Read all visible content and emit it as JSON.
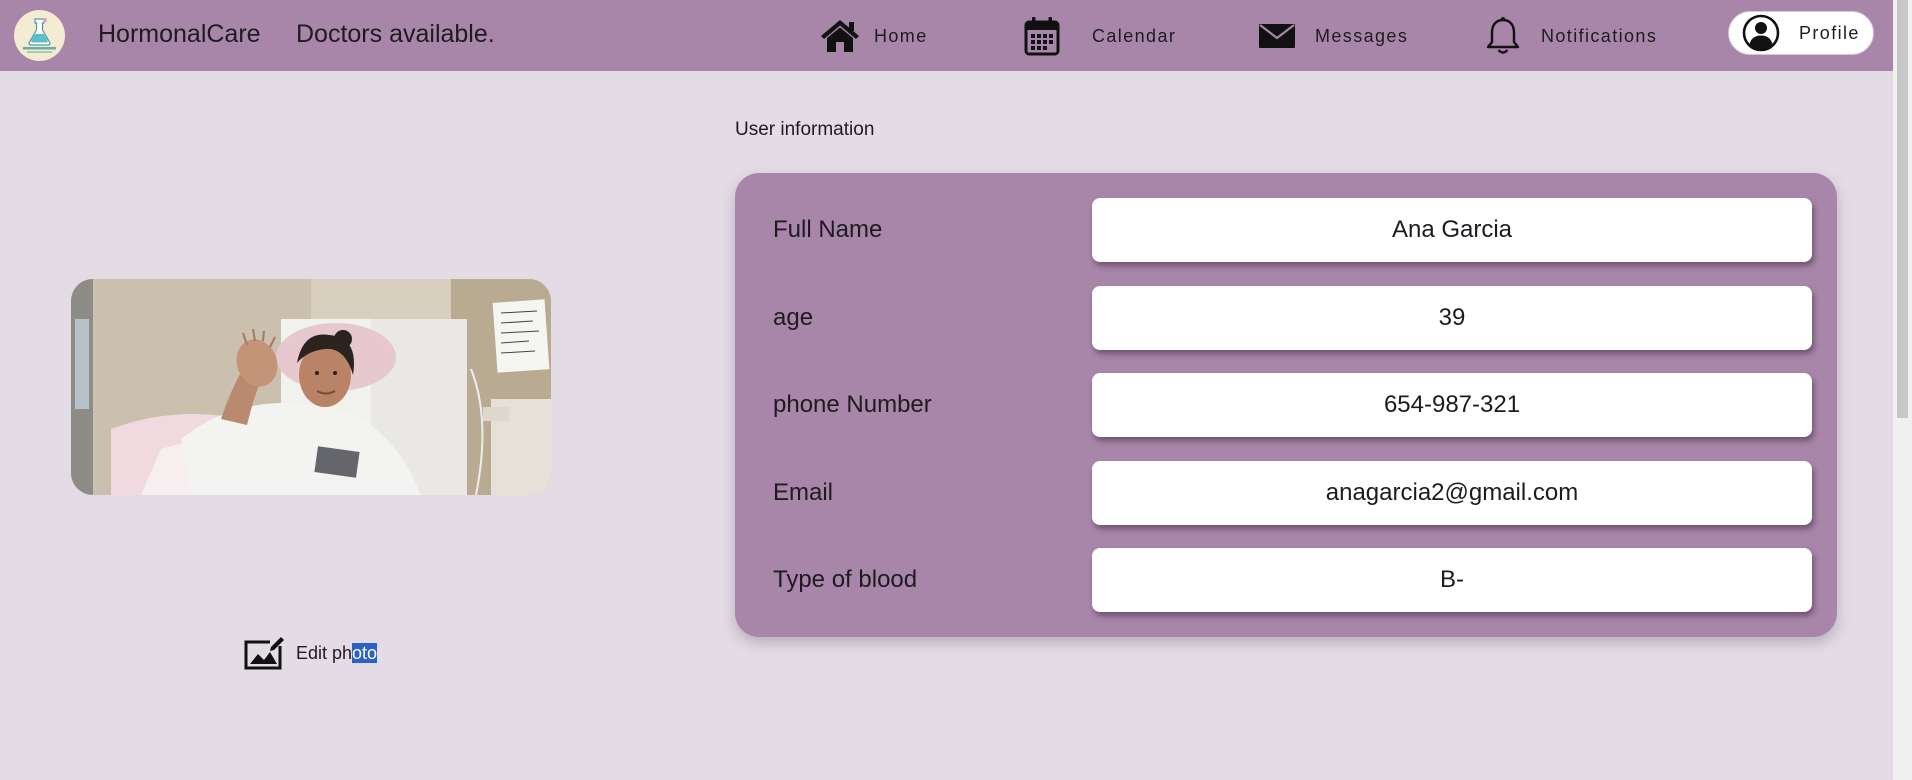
{
  "header": {
    "brand": "HormonalCare",
    "tagline": "Doctors available.",
    "background_color": "#a886a9",
    "nav": [
      {
        "label": "Home",
        "icon": "home-icon"
      },
      {
        "label": "Calendar",
        "icon": "calendar-icon"
      },
      {
        "label": "Messages",
        "icon": "mail-icon"
      },
      {
        "label": "Notifications",
        "icon": "bell-icon"
      }
    ],
    "profile": {
      "label": "Profile",
      "icon": "user-circle-icon"
    }
  },
  "photo_panel": {
    "photo_description": "patient photo",
    "edit_label_start": "Edit ph",
    "edit_label_selected": "oto",
    "edit_icon": "edit-image-icon"
  },
  "user_info": {
    "title": "User information",
    "fields": [
      {
        "label": "Full Name",
        "value": "Ana Garcia"
      },
      {
        "label": "age",
        "value": "39"
      },
      {
        "label": "phone Number",
        "value": "654-987-321"
      },
      {
        "label": "Email",
        "value": "anagarcia2@gmail.com"
      },
      {
        "label": "Type of blood",
        "value": "B-"
      }
    ]
  },
  "colors": {
    "page_background": "#e3dce5",
    "accent": "#a886a9",
    "selection": "#2c62c8"
  }
}
